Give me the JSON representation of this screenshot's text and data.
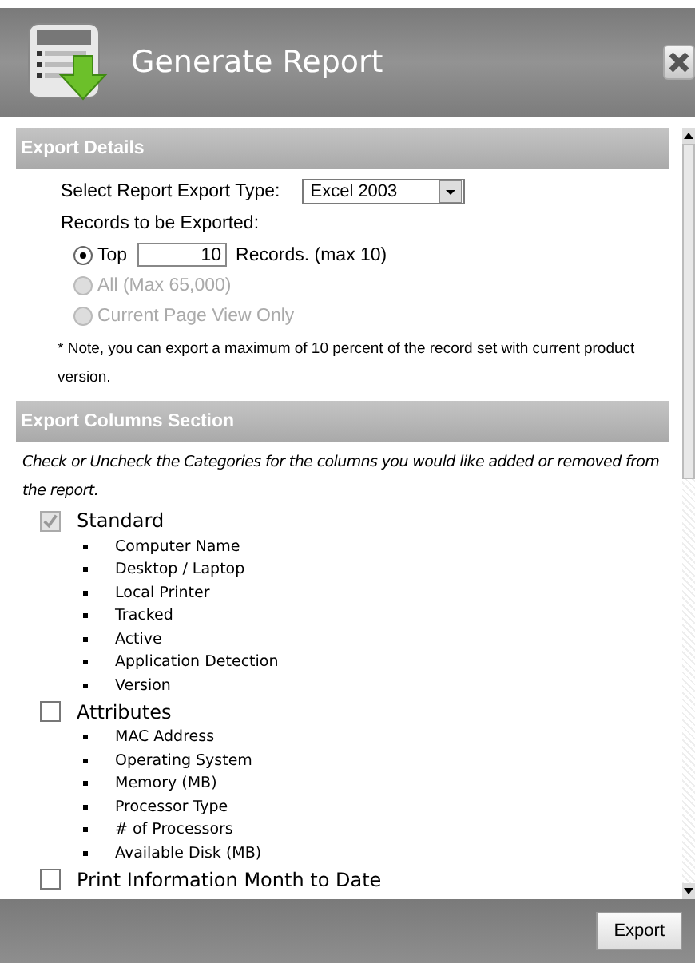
{
  "window": {
    "title": "Generate Report"
  },
  "export_details": {
    "heading": "Export Details",
    "export_type_label": "Select Report Export Type:",
    "export_type": "Excel 2003",
    "records_label": "Records to be Exported:",
    "options": [
      {
        "kind": "count",
        "label": "Top",
        "value": "10",
        "suffix": "Records. (max 10)",
        "selected": true,
        "disabled": false
      },
      {
        "kind": "plain",
        "label": "All (Max 65,000)",
        "selected": false,
        "disabled": true
      },
      {
        "kind": "plain",
        "label": "Current Page View Only",
        "selected": false,
        "disabled": true
      }
    ],
    "note": "* Note, you can export a maximum of 10 percent of the record set with current product version."
  },
  "export_columns": {
    "heading": "Export Columns Section",
    "instructions": "Check or Uncheck the Categories for the columns you would like added or removed from the report.",
    "categories": [
      {
        "label": "Standard",
        "checked": true,
        "disabled": true,
        "columns": [
          "Computer Name",
          "Desktop / Laptop",
          "Local Printer",
          "Tracked",
          "Active",
          "Application Detection",
          "Version"
        ]
      },
      {
        "label": "Attributes",
        "checked": false,
        "disabled": false,
        "columns": [
          "MAC Address",
          "Operating System",
          "Memory (MB)",
          "Processor Type",
          "# of Processors",
          "Available Disk (MB)"
        ]
      },
      {
        "label": "Print Information Month to Date",
        "checked": false,
        "disabled": false
      }
    ]
  },
  "buttons": [
    "Export"
  ]
}
